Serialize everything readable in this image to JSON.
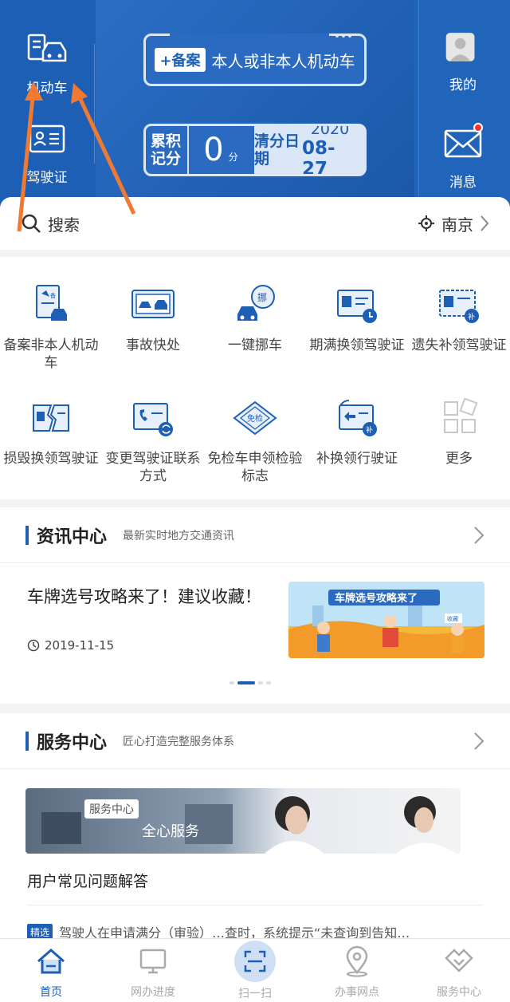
{
  "header": {
    "vehicle_label": "机动车",
    "license_label": "驾驶证",
    "mine_label": "我的",
    "message_label": "消息",
    "register_badge": "+备案",
    "register_text": "本人或非本人机动车",
    "points_label": "累积记分",
    "points_value": "0",
    "points_unit": "分",
    "clear_label": "清分日期",
    "clear_year": "2020",
    "clear_date": "08-27"
  },
  "search": {
    "label": "搜索",
    "city": "南京"
  },
  "grid": [
    {
      "label": "备案非本人机动车",
      "icon": "register-vehicle-icon"
    },
    {
      "label": "事故快处",
      "icon": "accident-icon"
    },
    {
      "label": "一键挪车",
      "icon": "move-car-icon"
    },
    {
      "label": "期满换领驾驶证",
      "icon": "license-renew-icon"
    },
    {
      "label": "遗失补领驾驶证",
      "icon": "license-lost-icon"
    },
    {
      "label": "损毁换领驾驶证",
      "icon": "license-damaged-icon"
    },
    {
      "label": "变更驾驶证联系方式",
      "icon": "contact-change-icon"
    },
    {
      "label": "免检车申领检验标志",
      "icon": "inspection-exempt-icon"
    },
    {
      "label": "补换领行驶证",
      "icon": "driving-permit-icon"
    },
    {
      "label": "更多",
      "icon": "more-icon"
    }
  ],
  "news": {
    "title": "资讯中心",
    "subtitle": "最新实时地方交通资讯",
    "item_title": "车牌选号攻略来了！建议收藏！",
    "item_date": "2019-11-15",
    "image_caption": "车牌选号攻略来了",
    "image_tag": "收藏"
  },
  "service": {
    "title": "服务中心",
    "subtitle": "匠心打造完整服务体系",
    "banner_tag": "服务中心",
    "banner_text": "全心服务",
    "faq": "用户常见问题解答",
    "tip_badge": "精选",
    "tip_text": "驾驶人在申请满分（审验）…查时，系统提示“未查询到告知…"
  },
  "tabbar": [
    {
      "label": "首页",
      "icon": "home-icon",
      "active": true
    },
    {
      "label": "网办进度",
      "icon": "monitor-icon",
      "active": false
    },
    {
      "label": "扫一扫",
      "icon": "scan-icon",
      "active": false
    },
    {
      "label": "办事网点",
      "icon": "location-pin-icon",
      "active": false
    },
    {
      "label": "服务中心",
      "icon": "handshake-icon",
      "active": false
    }
  ],
  "colors": {
    "brand": "#1d5fb5",
    "badge_red": "#ff3333",
    "annotation_arrow": "#f07a32"
  }
}
